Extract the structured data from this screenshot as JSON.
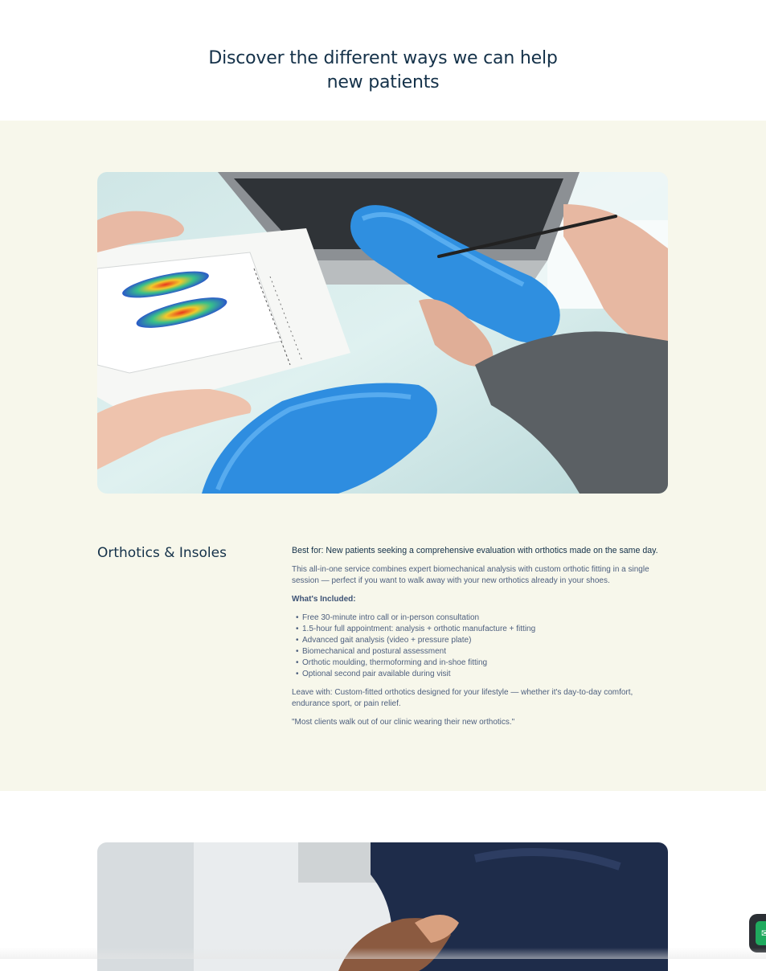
{
  "hero": {
    "title_line1": "Discover the different ways we can help",
    "title_line2": "new patients"
  },
  "service": {
    "title": "Orthotics & Insoles",
    "best_for": "Best for: New patients seeking a comprehensive evaluation with orthotics made on the same day.",
    "description": "This all-in-one service combines expert biomechanical analysis with custom orthotic fitting in a single session — perfect if you want to walk away with your new orthotics already in your shoes.",
    "included_label": "What's Included:",
    "included_items": [
      "Free 30-minute intro call or in-person consultation",
      "1.5-hour full appointment: analysis + orthotic manufacture + fitting",
      "Advanced gait analysis (video + pressure plate)",
      "Biomechanical and postural assessment",
      "Orthotic moulding, thermoforming and in-shoe fitting",
      "Optional second pair available during visit"
    ],
    "leave_with": "Leave with: Custom-fitted orthotics designed for your lifestyle — whether it's day-to-day comfort, endurance sport, or pain relief.",
    "quote": "\"Most clients walk out of our clinic wearing their new orthotics.\""
  },
  "chat_widget": {
    "icon": "chat-icon"
  },
  "colors": {
    "band_bg": "#f7f7eb",
    "heading": "#143149",
    "body": "#4d5f7e",
    "accent_green": "#1faa5e"
  }
}
